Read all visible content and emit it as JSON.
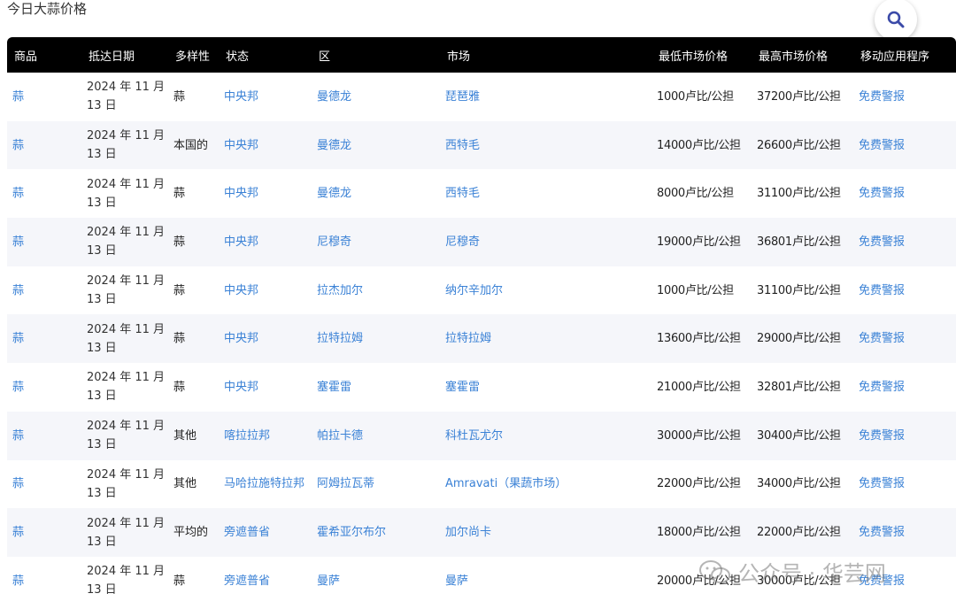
{
  "page": {
    "title": "今日大蒜价格",
    "watermark": "公众号 · 华芸网"
  },
  "table": {
    "headers": [
      "商品",
      "抵达日期",
      "多样性",
      "状态",
      "区",
      "市场",
      "最低市场价格",
      "最高市场价格",
      "移动应用程序"
    ],
    "rows": [
      {
        "commodity": "蒜",
        "date": "2024 年 11 月 13 日",
        "variety": "蒜",
        "state": "中央邦",
        "district": "曼德龙",
        "market": "琵琶雅",
        "min": "1000卢比/公担",
        "max": "37200卢比/公担",
        "app": "免费警报"
      },
      {
        "commodity": "蒜",
        "date": "2024 年 11 月 13 日",
        "variety": "本国的",
        "state": "中央邦",
        "district": "曼德龙",
        "market": "西特毛",
        "min": "14000卢比/公担",
        "max": "26600卢比/公担",
        "app": "免费警报"
      },
      {
        "commodity": "蒜",
        "date": "2024 年 11 月 13 日",
        "variety": "蒜",
        "state": "中央邦",
        "district": "曼德龙",
        "market": "西特毛",
        "min": "8000卢比/公担",
        "max": "31100卢比/公担",
        "app": "免费警报"
      },
      {
        "commodity": "蒜",
        "date": "2024 年 11 月 13 日",
        "variety": "蒜",
        "state": "中央邦",
        "district": "尼穆奇",
        "market": "尼穆奇",
        "min": "19000卢比/公担",
        "max": "36801卢比/公担",
        "app": "免费警报"
      },
      {
        "commodity": "蒜",
        "date": "2024 年 11 月 13 日",
        "variety": "蒜",
        "state": "中央邦",
        "district": "拉杰加尔",
        "market": "纳尔辛加尔",
        "min": "1000卢比/公担",
        "max": "31100卢比/公担",
        "app": "免费警报"
      },
      {
        "commodity": "蒜",
        "date": "2024 年 11 月 13 日",
        "variety": "蒜",
        "state": "中央邦",
        "district": "拉特拉姆",
        "market": "拉特拉姆",
        "min": "13600卢比/公担",
        "max": "29000卢比/公担",
        "app": "免费警报"
      },
      {
        "commodity": "蒜",
        "date": "2024 年 11 月 13 日",
        "variety": "蒜",
        "state": "中央邦",
        "district": "塞霍雷",
        "market": "塞霍雷",
        "min": "21000卢比/公担",
        "max": "32801卢比/公担",
        "app": "免费警报"
      },
      {
        "commodity": "蒜",
        "date": "2024 年 11 月 13 日",
        "variety": "其他",
        "state": "喀拉拉邦",
        "district": "帕拉卡德",
        "market": "科杜瓦尤尔",
        "min": "30000卢比/公担",
        "max": "30400卢比/公担",
        "app": "免费警报"
      },
      {
        "commodity": "蒜",
        "date": "2024 年 11 月 13 日",
        "variety": "其他",
        "state": "马哈拉施特拉邦",
        "district": "阿姆拉瓦蒂",
        "market": "Amravati（果蔬市场）",
        "min": "22000卢比/公担",
        "max": "34000卢比/公担",
        "app": "免费警报"
      },
      {
        "commodity": "蒜",
        "date": "2024 年 11 月 13 日",
        "variety": "平均的",
        "state": "旁遮普省",
        "district": "霍希亚尔布尔",
        "market": "加尔尚卡",
        "min": "18000卢比/公担",
        "max": "22000卢比/公担",
        "app": "免费警报"
      },
      {
        "commodity": "蒜",
        "date": "2024 年 11 月 13 日",
        "variety": "蒜",
        "state": "旁遮普省",
        "district": "曼萨",
        "market": "曼萨",
        "min": "20000卢比/公担",
        "max": "30000卢比/公担",
        "app": "免费警报"
      }
    ]
  },
  "icons": {
    "search": "search-icon",
    "watermark": "wechat-icon"
  },
  "colors": {
    "header_bg": "#000000",
    "link": "#3b82d6",
    "row_alt": "#f5f6fa"
  }
}
